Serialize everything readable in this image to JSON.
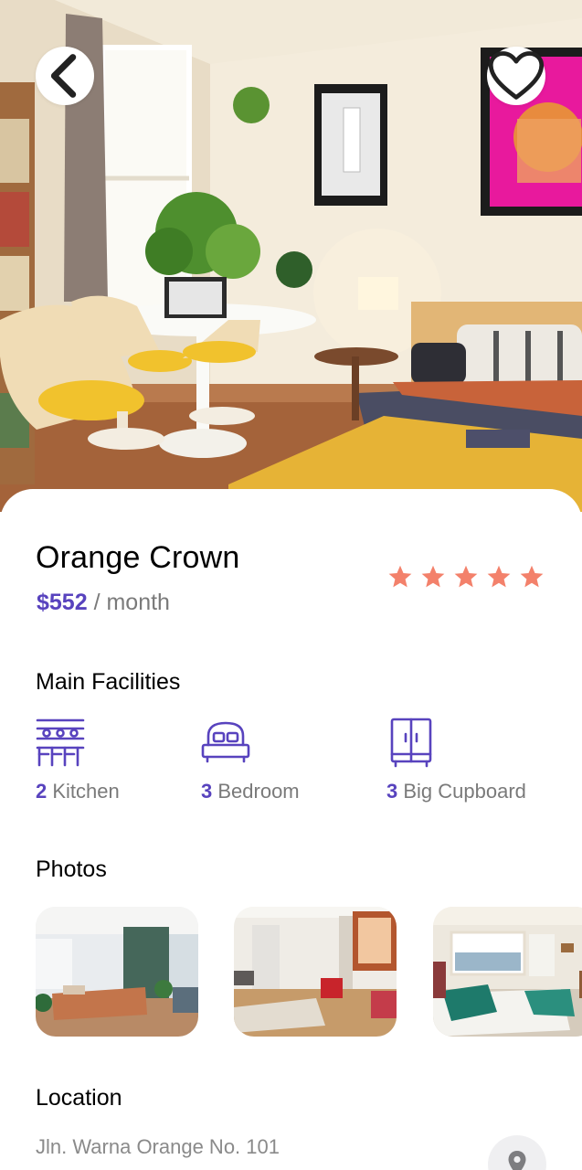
{
  "hero": {
    "image_name": "Bedroom with yellow chairs, round table, plants and bed"
  },
  "nav": {
    "back_icon": "chevron-left-icon",
    "favorite_icon": "heart-icon"
  },
  "listing": {
    "title": "Orange Crown",
    "price": "$552",
    "price_unit": " / month",
    "rating_stars": 5,
    "star_color": "#f3816b"
  },
  "facilities": {
    "title": "Main Facilities",
    "items": [
      {
        "count": "2",
        "label": " Kitchen",
        "icon": "kitchen-icon"
      },
      {
        "count": "3",
        "label": " Bedroom",
        "icon": "bed-icon"
      },
      {
        "count": "3",
        "label": " Big Cupboard",
        "icon": "cupboard-icon"
      }
    ]
  },
  "photos": {
    "title": "Photos"
  },
  "location": {
    "title": "Location",
    "address": "Jln. Warna Orange No. 101"
  },
  "colors": {
    "accent": "#5843be",
    "muted": "#7a7a7a",
    "star": "#f3816b"
  }
}
